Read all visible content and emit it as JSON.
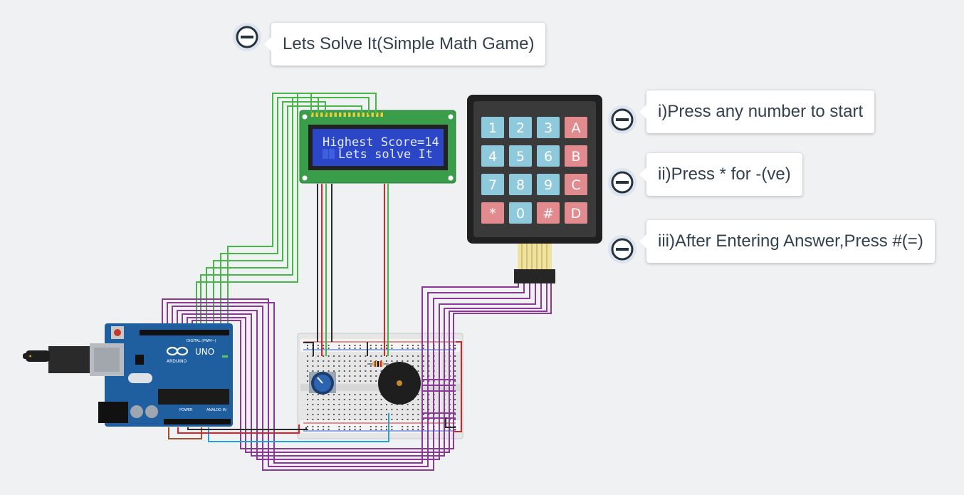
{
  "notes": {
    "title": "Lets Solve It(Simple Math Game)",
    "step1": "i)Press any number  to start",
    "step2": "ii)Press * for -(ve)",
    "step3": "iii)After Entering Answer,Press #(=)"
  },
  "lcd": {
    "line1": "Highest Score=14",
    "line2": "Lets solve It"
  },
  "keypad": {
    "rows": [
      [
        "1",
        "2",
        "3",
        "A"
      ],
      [
        "4",
        "5",
        "6",
        "B"
      ],
      [
        "7",
        "8",
        "9",
        "C"
      ],
      [
        "*",
        "0",
        "#",
        "D"
      ]
    ],
    "colors": {
      "digit": "#8ec9dc",
      "letter": "#e28b8f"
    }
  },
  "arduino": {
    "brand": "ARDUINO",
    "model": "UNO",
    "digital_label": "DIGITAL (PWM~)",
    "power_label": "POWER",
    "analog_label": "ANALOG IN"
  },
  "colors": {
    "green_wire": "#47b548",
    "purple_wire": "#8a3a96",
    "red_wire": "#d9252a",
    "black_wire": "#2b2b2b",
    "blue_wire": "#2a9fd6",
    "brown_wire": "#a0522d",
    "board": "#1f5fa0",
    "lcd_screen": "#2c46c8"
  },
  "icons": [
    "collapse-icon",
    "collapse-icon",
    "collapse-icon",
    "collapse-icon"
  ]
}
